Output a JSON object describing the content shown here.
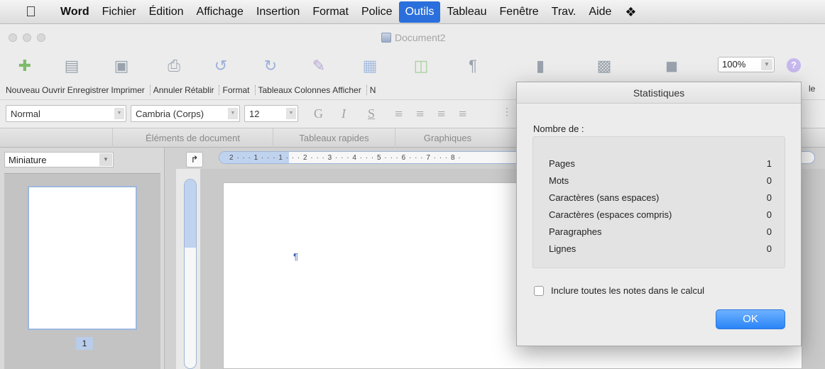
{
  "menubar": {
    "items": [
      "Word",
      "Fichier",
      "Édition",
      "Affichage",
      "Insertion",
      "Format",
      "Police",
      "Outils",
      "Tableau",
      "Fenêtre",
      "Trav.",
      "Aide"
    ],
    "active": "Outils"
  },
  "window": {
    "title": "Document2"
  },
  "toolbar": {
    "labels": [
      "Nouveau",
      "Ouvrir",
      "Enregistrer",
      "Imprimer",
      "Annuler",
      "Rétablir",
      "Format",
      "Tableaux",
      "Colonnes",
      "Afficher",
      "N"
    ],
    "zoom": "100%",
    "help_label": "le"
  },
  "formatbar": {
    "style": "Normal",
    "font": "Cambria (Corps)",
    "size": "12",
    "bold": "G",
    "italic": "I",
    "underline": "S"
  },
  "ribbon": {
    "tabs": [
      "Éléments de document",
      "Tableaux rapides",
      "Graphiques"
    ]
  },
  "sidebar": {
    "view": "Miniature",
    "page_number": "1"
  },
  "ruler": {
    "numbers": "2 · · · 1 · · · 1 · · · 2 · · · 3 · · · 4 · · · 5 · · · 6 · · · 7 · · · 8 ·"
  },
  "document": {
    "pilcrow": "¶"
  },
  "dialog": {
    "title": "Statistiques",
    "count_label": "Nombre de :",
    "stats": [
      {
        "label": "Pages",
        "value": "1"
      },
      {
        "label": "Mots",
        "value": "0"
      },
      {
        "label": "Caractères (sans espaces)",
        "value": "0"
      },
      {
        "label": "Caractères (espaces compris)",
        "value": "0"
      },
      {
        "label": "Paragraphes",
        "value": "0"
      },
      {
        "label": "Lignes",
        "value": "0"
      }
    ],
    "checkbox_label": "Inclure toutes les notes dans le calcul",
    "ok_label": "OK"
  }
}
